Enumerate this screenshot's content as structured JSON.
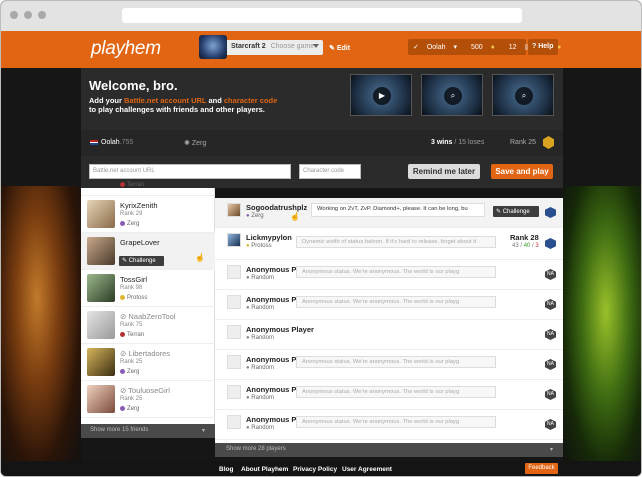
{
  "brand": {
    "logo": "playhem",
    "accent": "#e16512"
  },
  "header": {
    "game_name": "Starcraft 2",
    "choose_game": "Choose game",
    "edit": "Edit",
    "user": "Oolah",
    "coins": "500",
    "messages": "12",
    "notifications": "0",
    "help": "Help"
  },
  "welcome": {
    "title": "Welcome, bro.",
    "line1_a": "Add your ",
    "line1_link": "Battle.net account URL",
    "line1_b": " and ",
    "line1_link2": "character code",
    "line2": "to play challenges with friends and other players."
  },
  "stats": {
    "username": "Oolah",
    "points": ".755",
    "race": "Zerg",
    "wins": "3 wins",
    "loses": " / 15 loses",
    "rank": "Rank 25"
  },
  "form": {
    "bnet_placeholder": "Battle.net account URL",
    "code_placeholder": "Character code",
    "remind": "Remind me later",
    "save": "Save and play"
  },
  "friends": [
    {
      "name": "",
      "rank": "",
      "race": "Terran",
      "online": true
    },
    {
      "name": "KyrixZenith",
      "rank": "Rank 29",
      "race": "Zerg",
      "online": true
    },
    {
      "name": "GrapeLover",
      "rank": "",
      "race": "",
      "online": true,
      "challenge": "Challenge"
    },
    {
      "name": "TossGirl",
      "rank": "Rank 98",
      "race": "Protoss",
      "online": true
    },
    {
      "name": "NaabZeroTool",
      "rank": "Rank 75",
      "race": "Terran",
      "online": false
    },
    {
      "name": "Libertadores",
      "rank": "Rank 25",
      "race": "Zerg",
      "online": false
    },
    {
      "name": "TouluoseGirl",
      "rank": "Rank 25",
      "race": "Zerg",
      "online": false
    }
  ],
  "show_more_friends": "Show more 15 friends",
  "players": [
    {
      "name": "Sogoodatrushplz",
      "race": "Zerg",
      "status": "Working on ZvT, ZvP. Diamond+, please. It can be long, bu",
      "challenge": "Challenge"
    },
    {
      "name": "Lickmypylon",
      "race": "Protoss",
      "status": "Dynamic width of status baloon. If it's hard to release, forget about it",
      "rank": "Rank 28",
      "wins": "43",
      "draw": "40",
      "loss": "3"
    },
    {
      "name": "Anonymous Player",
      "race": "Random",
      "status": "Anonymous status. We're anonymous. The world is our playg"
    },
    {
      "name": "Anonymous Player",
      "race": "Random",
      "status": "Anonymous status. We're anonymous. The world is our playg"
    },
    {
      "name": "Anonymous Player",
      "race": "Random",
      "status": ""
    },
    {
      "name": "Anonymous Player",
      "race": "Random",
      "status": "Anonymous status. We're anonymous. The world is our playg"
    },
    {
      "name": "Anonymous Player",
      "race": "Random",
      "status": "Anonymous status. We're anonymous. The world is our playg"
    },
    {
      "name": "Anonymous Playe",
      "race": "Random",
      "status": "Anonymous status. We're anonymous. The world is our playg"
    }
  ],
  "na_badge": "NA",
  "show_more_players": "Show more 28 players",
  "footer": {
    "blog": "Blog",
    "about": "About Playhem",
    "privacy": "Privacy Policy",
    "agreement": "User Agreement",
    "feedback": "Feedback"
  }
}
